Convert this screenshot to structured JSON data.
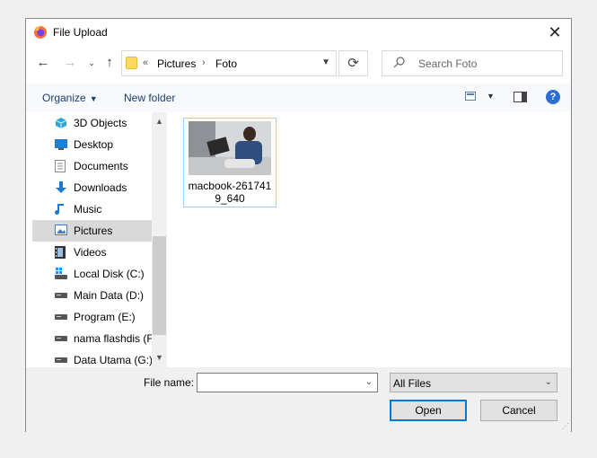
{
  "window": {
    "title": "File Upload"
  },
  "address": {
    "overflow": "«",
    "crumbs": [
      "Pictures",
      "Foto"
    ],
    "separator": "›"
  },
  "search": {
    "placeholder": "Search Foto"
  },
  "toolbar": {
    "organize_label": "Organize",
    "new_folder_label": "New folder"
  },
  "nav": {
    "items": [
      {
        "label": "3D Objects",
        "icon": "3d-objects-icon",
        "color": "#2fa8d8"
      },
      {
        "label": "Desktop",
        "icon": "desktop-icon",
        "color": "#1e7fd6"
      },
      {
        "label": "Documents",
        "icon": "documents-icon",
        "color": "#8a8a8a"
      },
      {
        "label": "Downloads",
        "icon": "downloads-icon",
        "color": "#1e78d6"
      },
      {
        "label": "Music",
        "icon": "music-icon",
        "color": "#1e78d6"
      },
      {
        "label": "Pictures",
        "icon": "pictures-icon",
        "color": "#3f7fbf",
        "selected": true
      },
      {
        "label": "Videos",
        "icon": "videos-icon",
        "color": "#333333"
      },
      {
        "label": "Local Disk (C:)",
        "icon": "system-drive-icon",
        "color": "#555555"
      },
      {
        "label": "Main Data (D:)",
        "icon": "drive-icon",
        "color": "#555555"
      },
      {
        "label": "Program (E:)",
        "icon": "drive-icon",
        "color": "#555555"
      },
      {
        "label": "nama flashdis (F",
        "icon": "drive-icon",
        "color": "#555555"
      },
      {
        "label": "Data Utama (G:)",
        "icon": "drive-icon",
        "color": "#555555"
      }
    ]
  },
  "files": [
    {
      "name": "macbook-2617419_640",
      "type": "image"
    }
  ],
  "bottom": {
    "file_name_label": "File name:",
    "file_name_value": "",
    "filter_value": "All Files",
    "open_label": "Open",
    "cancel_label": "Cancel"
  },
  "colors": {
    "accent": "#0078d7",
    "selection": "#d9d9d9",
    "tile_border": "#99d1ff"
  }
}
